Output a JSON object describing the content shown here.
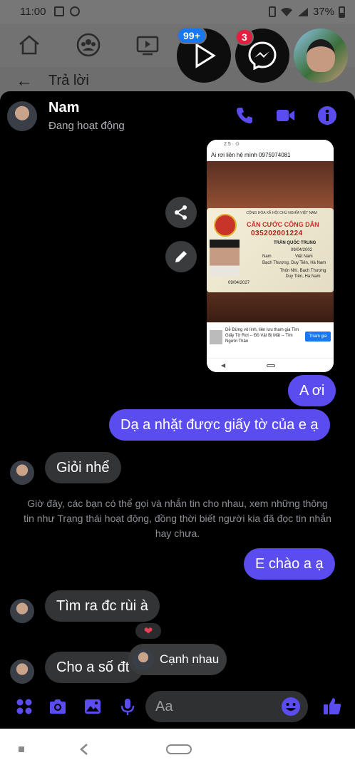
{
  "status_bar": {
    "time": "11:00",
    "battery": "37%"
  },
  "background": {
    "back_label": "Trả lời"
  },
  "chat_heads": {
    "badge_video": "99+",
    "badge_messenger": "3"
  },
  "header": {
    "name": "Nam",
    "status": "Đang hoạt động"
  },
  "shared_image": {
    "top_text": "Ai rơi liên hệ mình 0975974081",
    "card_title": "CĂN CƯỚC CÔNG DÂN",
    "card_number": "035202001224",
    "card_name": "TRẦN QUỐC TRUNG",
    "card_dob": "09/04/2002",
    "card_sex": "Nam",
    "card_nationality": "Việt Nam",
    "card_hometown": "Bạch Thượng, Duy Tiên, Hà Nam",
    "card_residence": "Thôn Nhì, Bạch Thượng Duy Tiên, Hà Nam",
    "card_expiry": "09/04/2027",
    "ad_text": "Dễ Đừng vô lình, liên lưu tham gia Tìm Giấy Tờ Rơi -- Đồ Vật Bị Mất -- Tìm Người Thân",
    "ad_button": "Tham gia"
  },
  "messages": [
    {
      "id": "m1",
      "dir": "out",
      "text": "A ơi"
    },
    {
      "id": "m2",
      "dir": "out",
      "text": "Dạ a nhặt được giấy tờ của e ạ"
    },
    {
      "id": "m3",
      "dir": "in",
      "text": "Giỏi nhể"
    },
    {
      "id": "m4",
      "dir": "out",
      "text": "E chào a ạ"
    },
    {
      "id": "m5",
      "dir": "in",
      "text": "Tìm ra đc rùi à"
    },
    {
      "id": "m6",
      "dir": "in",
      "text": "Cho a số đt"
    }
  ],
  "system_note": "Giờ đây, các bạn có thể gọi và nhắn tin cho nhau, xem những thông tin như Trạng thái hoạt động, đồng thời biết người kia đã đọc tin nhắn hay chưa.",
  "reaction": "❤",
  "chat_bubble_chip": {
    "label": "Cạnh nhau"
  },
  "composer": {
    "placeholder": "Aa"
  },
  "colors": {
    "accent": "#5b4cf0",
    "icon": "#5b4cf0",
    "panel": "#000000"
  },
  "icons": [
    "apps-icon",
    "camera-icon",
    "gallery-icon",
    "mic-icon",
    "emoji-icon",
    "like-icon",
    "phone-icon",
    "video-call-icon",
    "info-icon",
    "share-icon",
    "edit-icon"
  ]
}
